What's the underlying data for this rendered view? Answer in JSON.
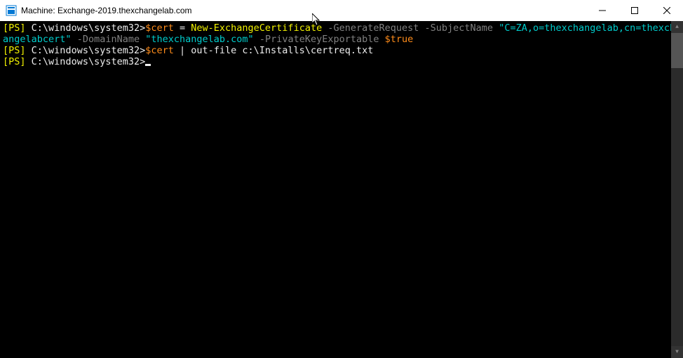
{
  "window": {
    "title": "Machine: Exchange-2019.thexchangelab.com"
  },
  "terminal": {
    "line1": {
      "ps_open": "[",
      "ps_label": "PS",
      "ps_close": "] ",
      "path": "C:\\windows\\system32>",
      "var": "$cert",
      "eq": " = ",
      "cmd": "New-ExchangeCertificate",
      "sp1": " ",
      "param1": "-GenerateRequest",
      "sp2": " ",
      "param2": "-SubjectName",
      "sp3": " ",
      "str1": "\"C=ZA,o=thexchangelab,cn=thexchangelabcert\"",
      "sp4": " ",
      "param3": "-DomainName",
      "sp5": " ",
      "str2": "\"thexchangelab.com\"",
      "sp6": " ",
      "param4": "-PrivateKeyExportable",
      "sp7": " ",
      "bool": "$true"
    },
    "line2": {
      "ps_open": "[",
      "ps_label": "PS",
      "ps_close": "] ",
      "path": "C:\\windows\\system32>",
      "var": "$cert",
      "rest": " | out-file c:\\Installs\\certreq.txt"
    },
    "line3": {
      "ps_open": "[",
      "ps_label": "PS",
      "ps_close": "] ",
      "path": "C:\\windows\\system32>"
    }
  }
}
